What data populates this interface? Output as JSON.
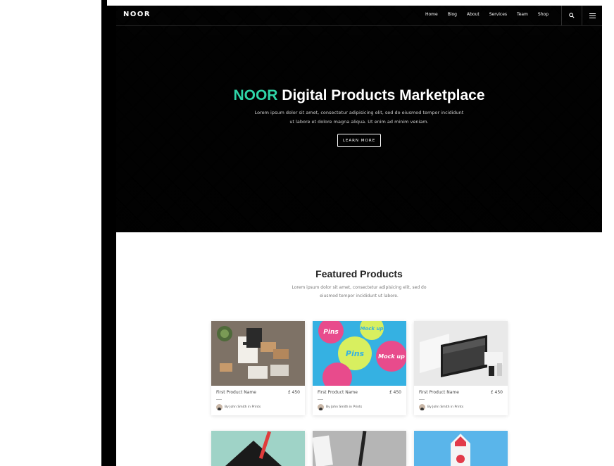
{
  "brand": {
    "logo": "NOOR"
  },
  "nav": {
    "items": [
      "Home",
      "Blog",
      "About",
      "Services",
      "Team",
      "Shop"
    ]
  },
  "hero": {
    "title_accent": "NOOR",
    "title_rest": " Digital Products Marketplace",
    "description": "Lorem ipsum dolor sit amet, consectetur adipisicing elit, sed do eiusmod tempor incididunt ut labore et dolore magna aliqua. Ut enim ad minim veniam.",
    "button": "LEARN MORE"
  },
  "featured": {
    "title": "Featured Products",
    "description": "Lorem ipsum dolor sit amet, consectetur adipisicing elit, sed do eiusmod tempor incididunt ut labore.",
    "products": [
      {
        "name": "First Product Name",
        "price": "£ 450",
        "author": "By John Smith in Prints"
      },
      {
        "name": "First Product Name",
        "price": "£ 450",
        "author": "By John Smith in Prints"
      },
      {
        "name": "First Product Name",
        "price": "£ 450",
        "author": "By John Smith in Prints"
      }
    ],
    "badge_text": [
      "Pins",
      "Mock up",
      "Pins",
      "Mock up"
    ]
  },
  "colors": {
    "accent": "#2fd5a8",
    "hero_bg": "#161616"
  },
  "icons": {
    "search": "search-icon",
    "menu": "hamburger-menu-icon"
  }
}
